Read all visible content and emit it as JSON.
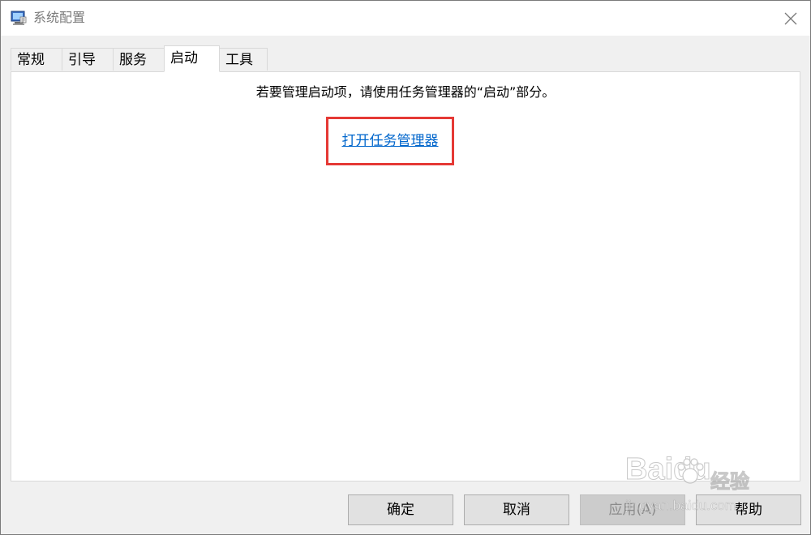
{
  "window": {
    "title": "系统配置",
    "icon": "msconfig-icon"
  },
  "tabs": [
    {
      "label": "常规",
      "active": false
    },
    {
      "label": "引导",
      "active": false
    },
    {
      "label": "服务",
      "active": false
    },
    {
      "label": "启动",
      "active": true
    },
    {
      "label": "工具",
      "active": false
    }
  ],
  "startup_panel": {
    "instruction": "若要管理启动项，请使用任务管理器的“启动”部分。",
    "link_label": "打开任务管理器",
    "highlight_color": "#e53935",
    "link_color": "#0066cc"
  },
  "buttons": {
    "ok": "确定",
    "cancel": "取消",
    "apply": "应用(A)",
    "help": "帮助"
  },
  "watermark": {
    "brand": "Baidu",
    "brand_cn": "经验",
    "url": "jingyan.baidu.com"
  }
}
